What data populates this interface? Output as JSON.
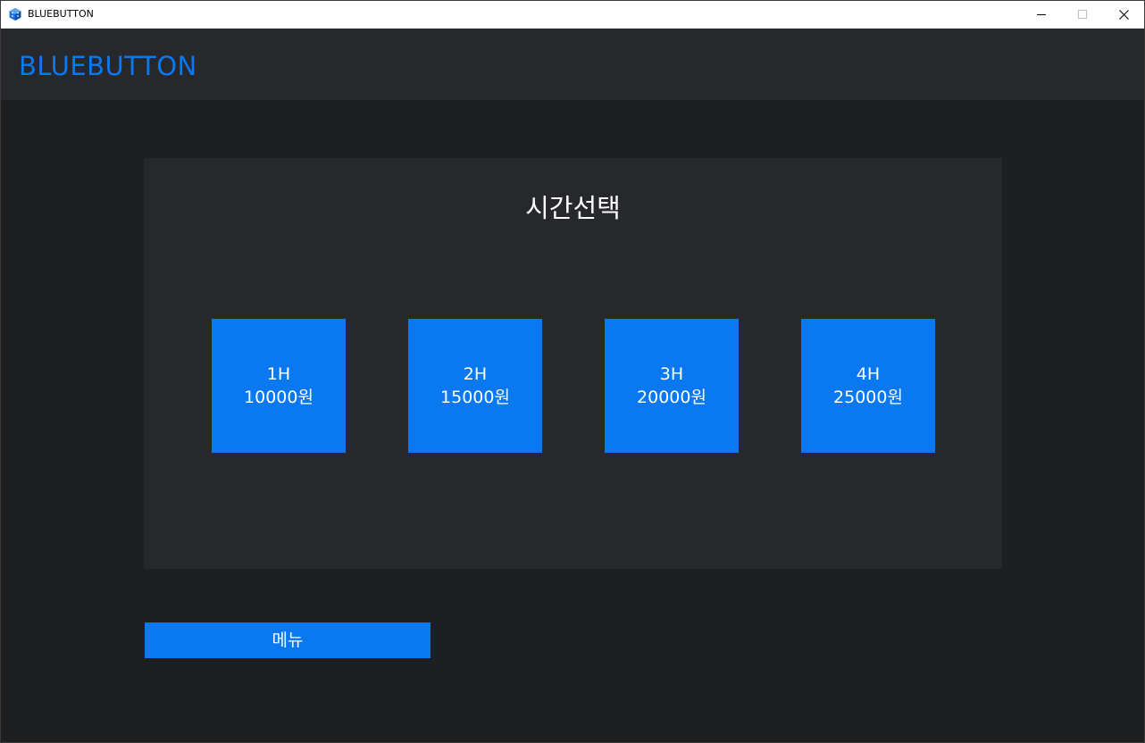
{
  "window": {
    "title": "BLUEBUTTON",
    "icon": "app-cube-icon",
    "controls": {
      "minimize_icon": "minimize-icon",
      "maximize_icon": "maximize-icon",
      "close_icon": "close-icon"
    }
  },
  "header": {
    "brand": "BLUEBUTTON"
  },
  "time_select": {
    "title": "시간선택",
    "options": [
      {
        "hours": "1H",
        "price": "10000원"
      },
      {
        "hours": "2H",
        "price": "15000원"
      },
      {
        "hours": "3H",
        "price": "20000원"
      },
      {
        "hours": "4H",
        "price": "25000원"
      }
    ]
  },
  "footer": {
    "menu_label": "메뉴"
  },
  "colors": {
    "accent": "#0a78f0",
    "background": "#1e1f21",
    "panel": "#27282c",
    "text": "#ffffff"
  }
}
